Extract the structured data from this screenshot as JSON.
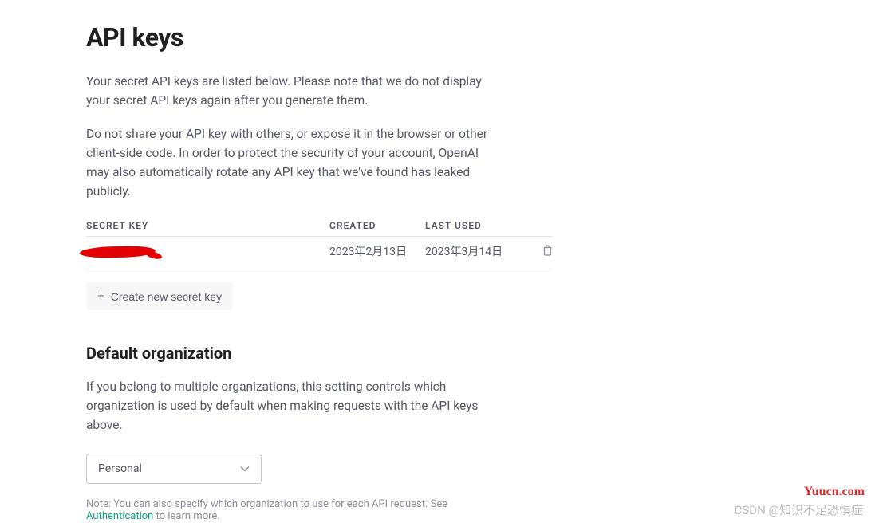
{
  "page": {
    "title": "API keys",
    "description1": "Your secret API keys are listed below. Please note that we do not display your secret API keys again after you generate them.",
    "description2": "Do not share your API key with others, or expose it in the browser or other client-side code. In order to protect the security of your account, OpenAI may also automatically rotate any API key that we've found has leaked publicly."
  },
  "table": {
    "headers": {
      "secret_key": "SECRET KEY",
      "created": "CREATED",
      "last_used": "LAST USED"
    },
    "rows": [
      {
        "key_display": "",
        "created": "2023年2月13日",
        "last_used": "2023年3月14日"
      }
    ]
  },
  "buttons": {
    "create_key": "Create new secret key",
    "plus_icon": "+"
  },
  "organization": {
    "heading": "Default organization",
    "description": "If you belong to multiple organizations, this setting controls which organization is used by default when making requests with the API keys above.",
    "selected": "Personal",
    "note_prefix": "Note: You can also specify which organization to use for each API request. See ",
    "note_link": "Authentication",
    "note_suffix": " to learn more."
  },
  "watermarks": {
    "yuucn": "Yuucn.com",
    "csdn": "CSDN @知识不足恐惧症"
  }
}
